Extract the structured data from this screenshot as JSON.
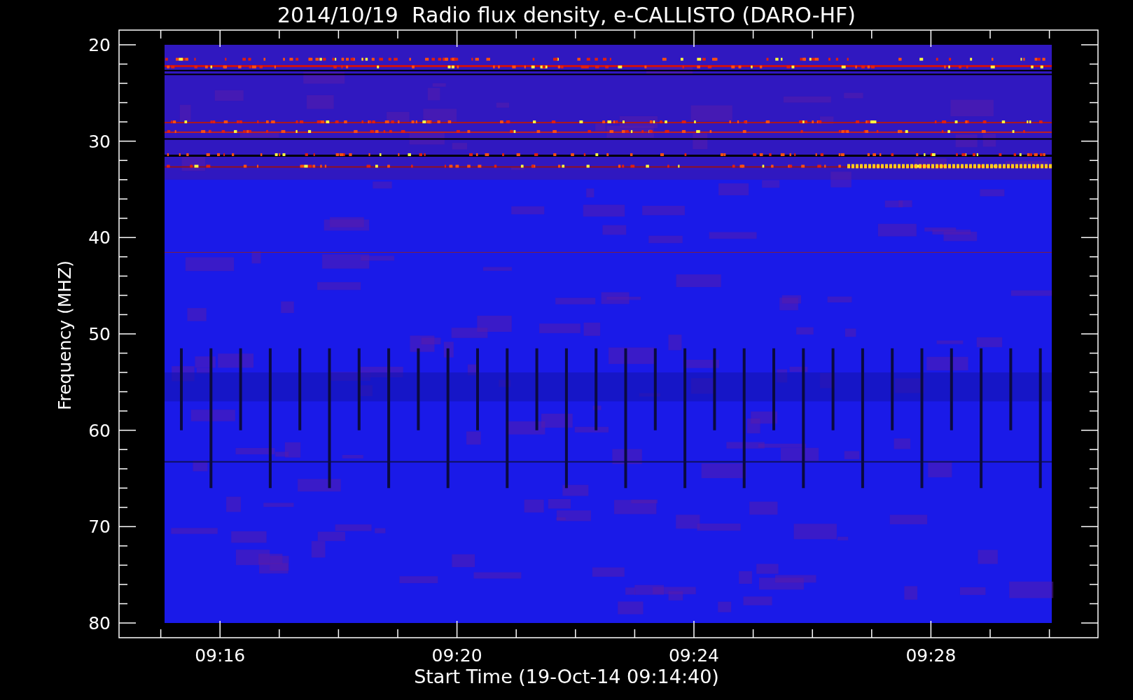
{
  "title": "2014/10/19  Radio flux density, e-CALLISTO (DARO-HF)",
  "y_axis": {
    "label": "Frequency (MHZ)",
    "ticks": [
      "20",
      "30",
      "40",
      "50",
      "60",
      "70",
      "80"
    ]
  },
  "x_axis": {
    "label": "Start Time (19-Oct-14 09:14:40)",
    "ticks": [
      "09:16",
      "09:20",
      "09:24",
      "09:28"
    ]
  }
}
